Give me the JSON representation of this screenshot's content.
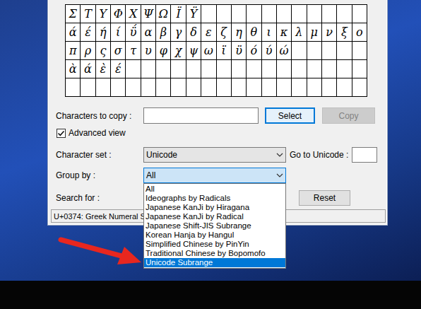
{
  "character_grid": {
    "rows": [
      [
        "Σ",
        "Τ",
        "Υ",
        "Φ",
        "Χ",
        "Ψ",
        "Ω",
        "Ϊ",
        "Ϋ"
      ],
      [
        "ά",
        "έ",
        "ή",
        "ί",
        "ΰ",
        "α",
        "β",
        "γ",
        "δ",
        "ε",
        "ζ",
        "η",
        "θ",
        "ι",
        "κ",
        "λ",
        "μ",
        "ν",
        "ξ",
        "ο"
      ],
      [
        "π",
        "ρ",
        "ς",
        "σ",
        "τ",
        "υ",
        "φ",
        "χ",
        "ψ",
        "ω",
        "ϊ",
        "ϋ",
        "ό",
        "ύ",
        "ώ"
      ],
      [
        "ὰ",
        "ά",
        "ὲ",
        "έ"
      ],
      []
    ]
  },
  "copy_field": {
    "label": "Characters to copy :",
    "value": ""
  },
  "select_button": {
    "label": "Select",
    "focused": true
  },
  "copy_button": {
    "label": "Copy",
    "disabled": true
  },
  "advanced_view": {
    "label": "Advanced view",
    "checked": true
  },
  "character_set": {
    "label": "Character set :",
    "value": "Unicode"
  },
  "go_to_unicode": {
    "label": "Go to Unicode :",
    "value": ""
  },
  "group_by": {
    "label": "Group by :",
    "value": "All",
    "expanded": true,
    "options": [
      {
        "label": "All",
        "selected": false
      },
      {
        "label": "Ideographs by Radicals",
        "selected": false
      },
      {
        "label": "Japanese KanJi by Hiragana",
        "selected": false
      },
      {
        "label": "Japanese KanJi by Radical",
        "selected": false
      },
      {
        "label": "Japanese Shift-JIS Subrange",
        "selected": false
      },
      {
        "label": "Korean Hanja by Hangul",
        "selected": false
      },
      {
        "label": "Simplified Chinese by PinYin",
        "selected": false
      },
      {
        "label": "Traditional Chinese by Bopomofo",
        "selected": false
      },
      {
        "label": "Unicode Subrange",
        "selected": true
      }
    ]
  },
  "search": {
    "label": "Search for :",
    "value": ""
  },
  "reset_button": {
    "label": "Reset"
  },
  "status_bar": "U+0374: Greek Numeral S"
}
